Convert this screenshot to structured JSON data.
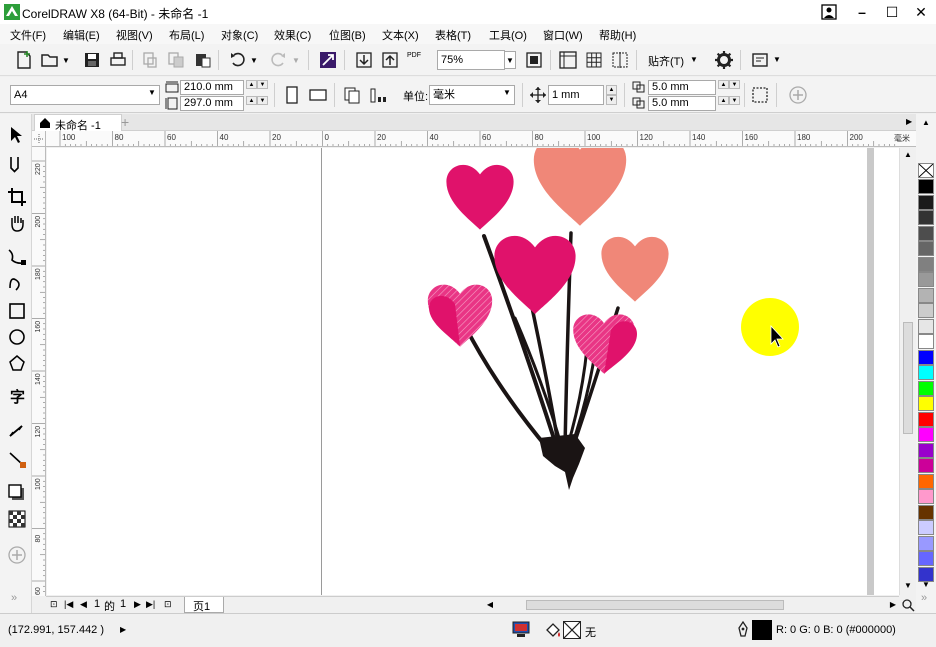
{
  "window": {
    "title": "CorelDRAW X8 (64-Bit) - 未命名 -1"
  },
  "menu": [
    "文件(F)",
    "编辑(E)",
    "视图(V)",
    "布局(L)",
    "对象(C)",
    "效果(C)",
    "位图(B)",
    "文本(X)",
    "表格(T)",
    "工具(O)",
    "窗口(W)",
    "帮助(H)"
  ],
  "standard_toolbar": {
    "zoom_value": "75%",
    "snap_label": "贴齐(T)",
    "pdf_label": "PDF"
  },
  "property_bar": {
    "page_size": "A4",
    "width": "210.0 mm",
    "height": "297.0 mm",
    "units_label": "单位:",
    "units_value": "毫米",
    "nudge": "1 mm",
    "dup_x": "5.0 mm",
    "dup_y": "5.0 mm"
  },
  "document_tab": {
    "label": "未命名 -1"
  },
  "hruler_labels": [
    "100",
    "80",
    "60",
    "40",
    "20",
    "0",
    "20",
    "40",
    "60",
    "80",
    "100",
    "120",
    "140",
    "160",
    "180",
    "200"
  ],
  "hruler_unit": "毫米",
  "vruler_labels": [
    "220",
    "200",
    "180",
    "160",
    "140",
    "120",
    "100",
    "80",
    "60"
  ],
  "page_nav": {
    "current": "1",
    "of_label": "的",
    "total": "1",
    "page_tab": "页1"
  },
  "status": {
    "coords": "(172.991, 157.442 )",
    "fill_label": "无",
    "color_info": "R: 0 G: 0 B: 0 (#000000)"
  },
  "palette_colors": [
    "#000000",
    "#1a1a1a",
    "#333333",
    "#4d4d4d",
    "#666666",
    "#808080",
    "#999999",
    "#b3b3b3",
    "#cccccc",
    "#e6e6e6",
    "#ffffff",
    "#0000ff",
    "#00ffff",
    "#00ff00",
    "#ffff00",
    "#ff0000",
    "#ff00ff",
    "#9900cc",
    "#cc0099",
    "#ff6600",
    "#ff99cc",
    "#663300",
    "#ccccff",
    "#9999ff",
    "#6666ff",
    "#3333cc"
  ],
  "colors": {
    "accent_yellow": "#ffff00",
    "heart_pink": "#e0126b",
    "heart_salmon": "#f08778",
    "stem": "#1a1414"
  }
}
